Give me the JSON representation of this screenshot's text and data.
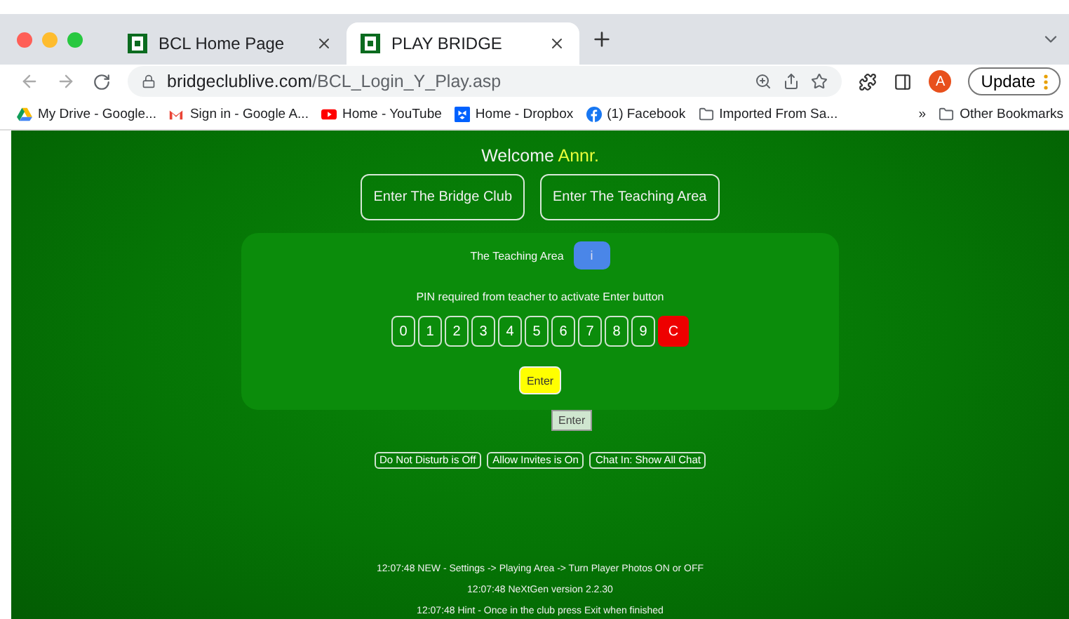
{
  "browser": {
    "tabs": [
      {
        "title": "BCL Home Page",
        "selected": false
      },
      {
        "title": "PLAY BRIDGE",
        "selected": true
      }
    ],
    "address": {
      "host": "bridgeclublive.com",
      "path": "/BCL_Login_Y_Play.asp"
    },
    "profile_initial": "A",
    "update_label": "Update",
    "bookmarks": [
      {
        "kind": "drive",
        "label": "My Drive - Google..."
      },
      {
        "kind": "gmail",
        "label": "Sign in - Google A..."
      },
      {
        "kind": "youtube",
        "label": "Home - YouTube"
      },
      {
        "kind": "dropbox",
        "label": "Home - Dropbox"
      },
      {
        "kind": "facebook",
        "label": "(1) Facebook"
      },
      {
        "kind": "folder",
        "label": "Imported From Sa..."
      }
    ],
    "overflow": "»",
    "other_bookmarks": "Other Bookmarks"
  },
  "page": {
    "welcome": "Welcome",
    "user": "Annr.",
    "main_buttons": [
      "Enter The Bridge Club",
      "Enter The Teaching Area"
    ],
    "teaching_label": "The Teaching Area",
    "info_button": "i",
    "pin_hint": "PIN required from teacher to activate Enter button",
    "keys": [
      "0",
      "1",
      "2",
      "3",
      "4",
      "5",
      "6",
      "7",
      "8",
      "9"
    ],
    "clear_key": "C",
    "enter_button": "Enter",
    "tooltip": "Enter",
    "toggles": [
      {
        "label": "Do Not Disturb is Off"
      },
      {
        "label": "Allow Invites is On"
      },
      {
        "label": "Chat In: Show All Chat"
      }
    ],
    "messages": [
      "12:07:48 NEW - Settings -> Playing Area -> Turn Player Photos ON or OFF",
      "12:07:48 NeXtGen version 2.2.30",
      "12:07:48 Hint - Once in the club press Exit when finished"
    ]
  }
}
